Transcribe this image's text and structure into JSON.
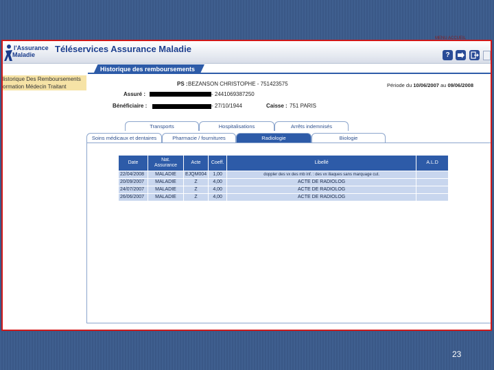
{
  "app": {
    "logo_line1": "l'Assurance",
    "logo_line2": "Maladie",
    "title": "Téléservices Assurance Maladie",
    "topright_text": "MENU  ACCUEIL",
    "help_icon": "?",
    "colors": {
      "brand_blue": "#2d5ba8",
      "frame_red": "#d01818",
      "sidebar_yellow": "#f6e3a6",
      "row_blue": "#c8d6ee"
    }
  },
  "sidebar": {
    "items": [
      {
        "label": "listorique Des Remboursements"
      },
      {
        "label": "ormation Médecin Traitant"
      }
    ]
  },
  "section": {
    "title": "Historique des remboursements"
  },
  "patient": {
    "ps_label": "PS :",
    "ps_value": "BEZANSON  CHRISTOPHE - 751423575",
    "period_prefix": "Période du",
    "period_from": "10/06/2007",
    "period_mid": "au",
    "period_to": "09/06/2008",
    "assure_label": "Assuré :",
    "assure_value": "- 2441069387250",
    "beneficiaire_label": "Bénéficiaire :",
    "beneficiaire_value": "- 27/10/1944",
    "caisse_label": "Caisse :",
    "caisse_value": "751 PARIS"
  },
  "tabs_row1": [
    {
      "label": "Transports"
    },
    {
      "label": "Hospitalisations"
    },
    {
      "label": "Arrêts indemnisés"
    }
  ],
  "tabs_row2": [
    {
      "label": "Soins médicaux et dentaires"
    },
    {
      "label": "Pharmacie / fournitures"
    },
    {
      "label": "Radiologie"
    },
    {
      "label": "Biologie"
    }
  ],
  "table": {
    "headers": [
      "Date",
      "Nat. Assurance",
      "Acte",
      "Coeff.",
      "Libellé",
      "A.L.D"
    ],
    "rows": [
      [
        "22/04/2008",
        "MALADIE",
        "EJQM004",
        "1,00",
        "doppler des vx des mb inf. : des vx iliaques sans marquage cut.",
        ""
      ],
      [
        "20/09/2007",
        "MALADIE",
        "Z",
        "4,00",
        "ACTE DE RADIOLOG",
        ""
      ],
      [
        "24/07/2007",
        "MALADIE",
        "Z",
        "4,00",
        "ACTE DE RADIOLOG",
        ""
      ],
      [
        "26/06/2007",
        "MALADIE",
        "Z",
        "4,00",
        "ACTE DE RADIOLOG",
        ""
      ]
    ]
  },
  "footer": {
    "page_number": "23"
  }
}
